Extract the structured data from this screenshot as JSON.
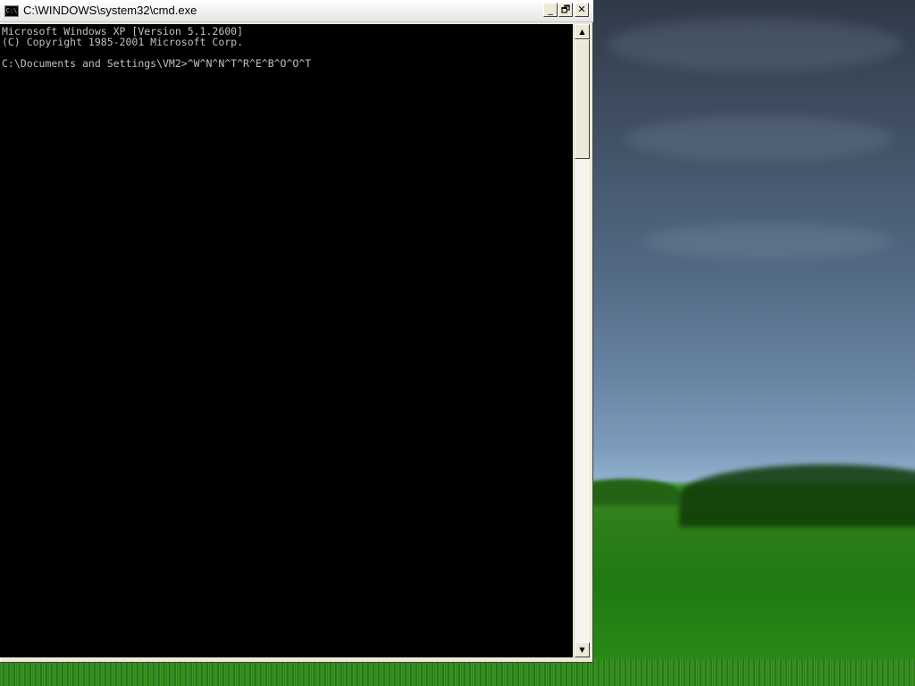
{
  "window": {
    "title": "C:\\WINDOWS\\system32\\cmd.exe",
    "icon_label": "C:\\",
    "controls": {
      "minimize": "_",
      "restore": "🗗",
      "close": "✕"
    }
  },
  "console": {
    "lines": [
      "Microsoft Windows XP [Version 5.1.2600]",
      "(C) Copyright 1985-2001 Microsoft Corp.",
      "",
      "C:\\Documents and Settings\\VM2>^W^N^N^T^R^E^B^O^O^T"
    ]
  },
  "scrollbar": {
    "up_glyph": "▲",
    "down_glyph": "▼"
  }
}
